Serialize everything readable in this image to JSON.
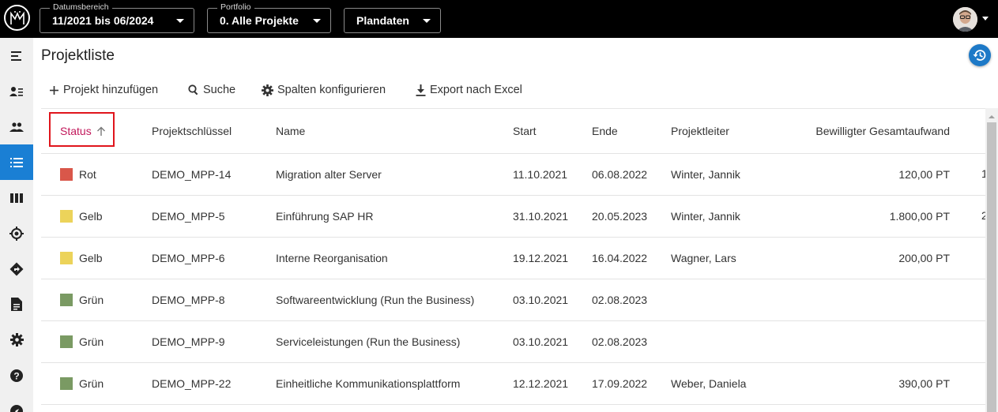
{
  "topbar": {
    "date_range": {
      "label": "Datumsbereich",
      "value": "11/2021 bis 06/2024"
    },
    "portfolio": {
      "label": "Portfolio",
      "value": "0. Alle Projekte"
    },
    "data_mode": {
      "value": "Plandaten"
    }
  },
  "sidebar": {
    "items": [
      {
        "icon": "menu-collapse-icon"
      },
      {
        "icon": "person-list-icon"
      },
      {
        "icon": "group-icon"
      },
      {
        "icon": "list-icon",
        "active": true
      },
      {
        "icon": "columns-icon"
      },
      {
        "icon": "target-icon"
      },
      {
        "icon": "directions-icon"
      },
      {
        "icon": "document-icon"
      },
      {
        "icon": "settings-icon"
      },
      {
        "icon": "help-icon"
      },
      {
        "icon": "compass-icon"
      }
    ]
  },
  "page": {
    "title": "Projektliste"
  },
  "toolbar": {
    "add_label": "Projekt hinzufügen",
    "search_label": "Suche",
    "columns_label": "Spalten konfigurieren",
    "export_label": "Export nach Excel"
  },
  "table": {
    "headers": {
      "status": "Status",
      "key": "Projektschlüssel",
      "name": "Name",
      "start": "Start",
      "end": "Ende",
      "lead": "Projektleiter",
      "effort": "Bewilligter Gesamtaufwand"
    },
    "colors": {
      "Rot": "#d9574a",
      "Gelb": "#ecd35a",
      "Grün": "#7a9a63"
    },
    "rows": [
      {
        "status": "Rot",
        "key": "DEMO_MPP-14",
        "name": "Migration alter Server",
        "start": "11.10.2021",
        "end": "06.08.2022",
        "lead": "Winter, Jannik",
        "effort": "120,00 PT"
      },
      {
        "status": "Gelb",
        "key": "DEMO_MPP-5",
        "name": "Einführung SAP HR",
        "start": "31.10.2021",
        "end": "20.05.2023",
        "lead": "Winter, Jannik",
        "effort": "1.800,00 PT"
      },
      {
        "status": "Gelb",
        "key": "DEMO_MPP-6",
        "name": "Interne Reorganisation",
        "start": "19.12.2021",
        "end": "16.04.2022",
        "lead": "Wagner, Lars",
        "effort": "200,00 PT"
      },
      {
        "status": "Grün",
        "key": "DEMO_MPP-8",
        "name": "Softwareentwicklung (Run the Business)",
        "start": "03.10.2021",
        "end": "02.08.2023",
        "lead": "",
        "effort": ""
      },
      {
        "status": "Grün",
        "key": "DEMO_MPP-9",
        "name": "Serviceleistungen (Run the Business)",
        "start": "03.10.2021",
        "end": "02.08.2023",
        "lead": "",
        "effort": ""
      },
      {
        "status": "Grün",
        "key": "DEMO_MPP-22",
        "name": "Einheitliche Kommunikationsplattform",
        "start": "12.12.2021",
        "end": "17.09.2022",
        "lead": "Weber, Daniela",
        "effort": "390,00 PT"
      }
    ],
    "clipped_next_column": [
      "1",
      "2"
    ]
  }
}
